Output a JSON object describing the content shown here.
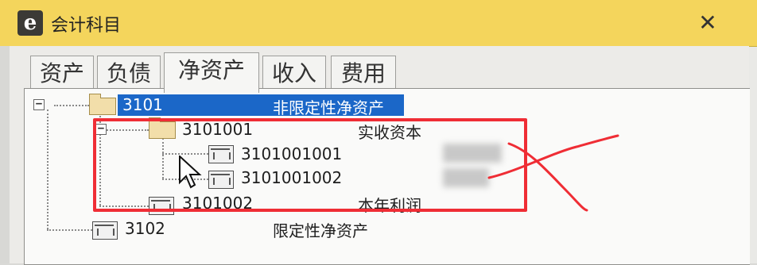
{
  "window": {
    "title": "会计科目",
    "app_icon": "e",
    "close_symbol": "✕"
  },
  "tabs": [
    {
      "label": "资产",
      "active": false
    },
    {
      "label": "负债",
      "active": false
    },
    {
      "label": "净资产",
      "active": true
    },
    {
      "label": "收入",
      "active": false
    },
    {
      "label": "费用",
      "active": false
    }
  ],
  "tree": {
    "root": {
      "code": "3101",
      "name": "非限定性净资产",
      "selected": true
    },
    "child": {
      "code": "3101001",
      "name": "实收资本"
    },
    "grandchildren": [
      {
        "code": "3101001001"
      },
      {
        "code": "3101001002"
      }
    ],
    "sibling_child": {
      "code": "3101002",
      "name": "本年利润"
    },
    "second_root": {
      "code": "3102",
      "name": "限定性净资产"
    }
  },
  "annotations": {
    "highlight_color": "#ef2d35",
    "selection_color": "#1b67c8"
  },
  "icons": [
    "app-e-icon",
    "close-icon",
    "folder-icon",
    "account-leaf-icon",
    "mouse-cursor-icon",
    "expander-minus-icon"
  ]
}
